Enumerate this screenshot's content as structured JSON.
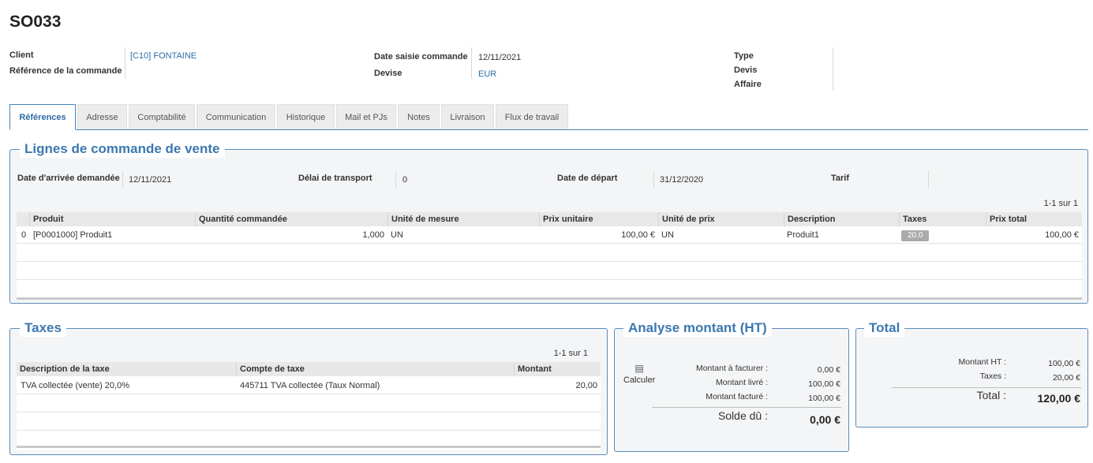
{
  "header": {
    "title": "SO033",
    "client_label": "Client",
    "client_value": "[C10] FONTAINE",
    "ref_label": "Référence de la commande",
    "date_saisie_label": "Date saisie commande",
    "date_saisie_value": "12/11/2021",
    "devise_label": "Devise",
    "devise_value": "EUR",
    "type_label": "Type",
    "devis_label": "Devis",
    "affaire_label": "Affaire"
  },
  "tabs": [
    {
      "label": "Références",
      "active": true
    },
    {
      "label": "Adresse"
    },
    {
      "label": "Comptabilité"
    },
    {
      "label": "Communication"
    },
    {
      "label": "Historique"
    },
    {
      "label": "Mail et PJs"
    },
    {
      "label": "Notes"
    },
    {
      "label": "Livraison"
    },
    {
      "label": "Flux de travail"
    }
  ],
  "lignes": {
    "legend": "Lignes de commande de vente",
    "date_arrivee_label": "Date d'arrivée demandée",
    "date_arrivee_value": "12/11/2021",
    "delai_label": "Délai de transport",
    "delai_value": "0",
    "date_depart_label": "Date de départ",
    "date_depart_value": "31/12/2020",
    "tarif_label": "Tarif",
    "pager": "1-1 sur 1",
    "columns": [
      "Produit",
      "Quantité commandée",
      "Unité de mesure",
      "Prix unitaire",
      "Unité de prix",
      "Description",
      "Taxes",
      "Prix total"
    ],
    "rows": [
      {
        "num": "0",
        "produit": "[P0001000] Produit1",
        "quantite": "1,000",
        "unite": "UN",
        "prix_unitaire": "100,00 €",
        "unite_prix": "UN",
        "description": "Produit1",
        "taxes": "20.0",
        "prix_total": "100,00 €"
      }
    ]
  },
  "taxes": {
    "legend": "Taxes",
    "pager": "1-1 sur 1",
    "columns": [
      "Description de la taxe",
      "Compte de taxe",
      "Montant"
    ],
    "rows": [
      {
        "description": "TVA collectée (vente) 20,0%",
        "compte": "445711 TVA collectée (Taux Normal)",
        "montant": "20,00"
      }
    ]
  },
  "analyse": {
    "legend": "Analyse montant (HT)",
    "calc_icon": "calculator-icon",
    "calc_label": "Calculer",
    "a_facturer_label": "Montant à facturer :",
    "a_facturer_value": "0,00 €",
    "livre_label": "Montant livré :",
    "livre_value": "100,00 €",
    "facture_label": "Montant facturé :",
    "facture_value": "100,00 €",
    "solde_label": "Solde dû :",
    "solde_value": "0,00 €"
  },
  "total": {
    "legend": "Total",
    "ht_label": "Montant HT :",
    "ht_value": "100,00 €",
    "taxes_label": "Taxes :",
    "taxes_value": "20,00 €",
    "total_label": "Total :",
    "total_value": "120,00 €"
  }
}
